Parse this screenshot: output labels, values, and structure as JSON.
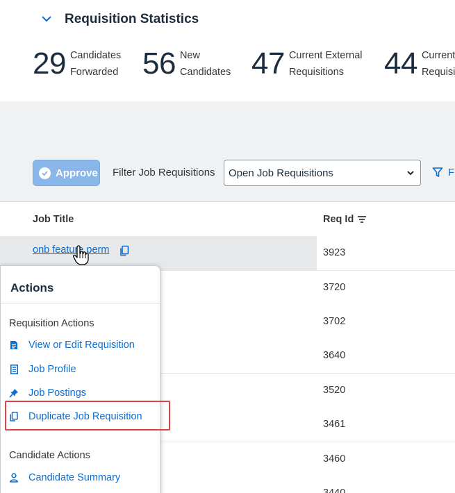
{
  "stats": {
    "title": "Requisition Statistics",
    "items": [
      {
        "value": "29",
        "label_line1": "Candidates",
        "label_line2": "Forwarded"
      },
      {
        "value": "56",
        "label_line1": "New",
        "label_line2": "Candidates"
      },
      {
        "value": "47",
        "label_line1": "Current External",
        "label_line2": "Requisitions"
      },
      {
        "value": "44",
        "label_line1": "Current",
        "label_line2": "Requisitions"
      }
    ]
  },
  "toolbar": {
    "approve_label": "Approve",
    "filter_label": "Filter Job Requisitions",
    "filter_value": "Open Job Requisitions",
    "filter_link": "Fi"
  },
  "table": {
    "columns": {
      "job_title": "Job Title",
      "req_id": "Req Id"
    },
    "rows": [
      {
        "title": "onb feature perm",
        "req_id": "3923"
      },
      {
        "title": "",
        "req_id": "3720"
      },
      {
        "title": "",
        "req_id": "3702"
      },
      {
        "title": "",
        "req_id": "3640"
      },
      {
        "title": "",
        "req_id": "3520"
      },
      {
        "title": "",
        "req_id": "3461"
      },
      {
        "title": "",
        "req_id": "3460"
      },
      {
        "title": "",
        "req_id": "3440"
      }
    ]
  },
  "actions": {
    "title": "Actions",
    "requisition_group": "Requisition Actions",
    "requisition_items": [
      {
        "label": "View or Edit Requisition",
        "icon": "document-icon"
      },
      {
        "label": "Job Profile",
        "icon": "profile-grid-icon"
      },
      {
        "label": "Job Postings",
        "icon": "pushpin-icon"
      },
      {
        "label": "Duplicate Job Requisition",
        "icon": "copy-icon"
      }
    ],
    "candidate_group": "Candidate Actions",
    "candidate_items": [
      {
        "label": "Candidate Summary",
        "icon": "person-icon"
      }
    ]
  },
  "colors": {
    "link": "#0a6ed1",
    "approve_bg": "#8ab7ea",
    "highlight": "#e2413d",
    "band": "#eff1f2"
  }
}
